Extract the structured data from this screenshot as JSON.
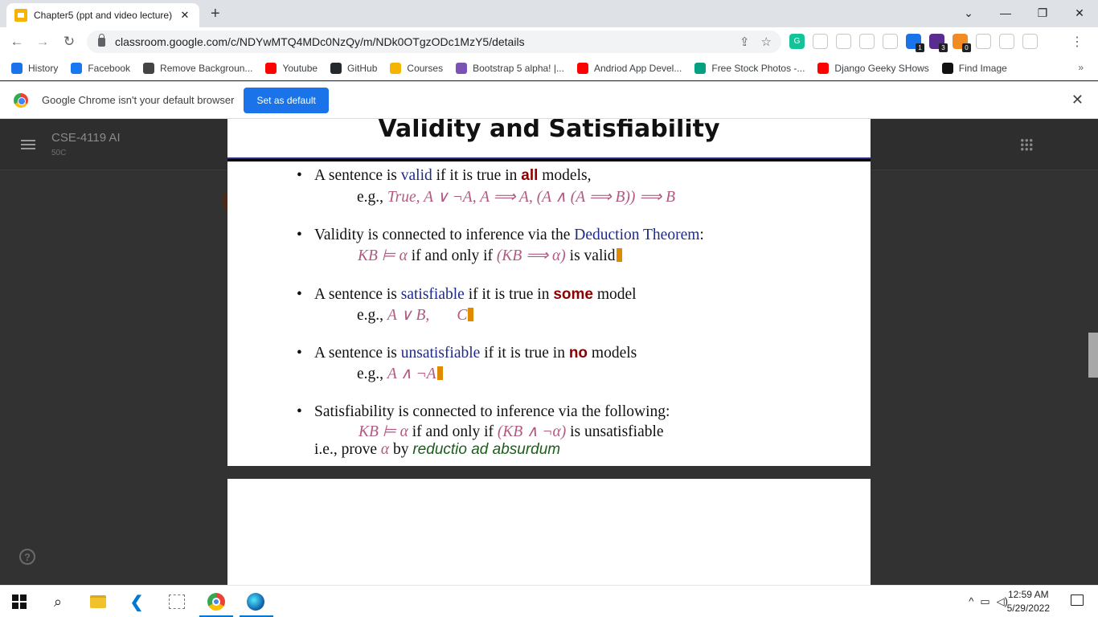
{
  "browser": {
    "tab_title": "Chapter5 (ppt and video lecture)",
    "tab_close": "✕",
    "new_tab": "+",
    "url": "classroom.google.com/c/NDYwMTQ4MDc0NzQy/m/NDk0OTgzODc1MzY5/details",
    "window_controls": {
      "dropdown": "⌄",
      "minimize": "—",
      "restore": "❐",
      "close": "✕"
    },
    "nav": {
      "back": "←",
      "forward": "→",
      "reload": "↻"
    },
    "extensions": [
      {
        "name": "grammarly-icon",
        "color": "#15c39a",
        "label": "G",
        "badge": ""
      },
      {
        "name": "runner-icon",
        "color": "#ffffff",
        "label": "",
        "badge": ""
      },
      {
        "name": "eyedropper-icon",
        "color": "#ffffff",
        "label": "",
        "badge": ""
      },
      {
        "name": "bug-icon",
        "color": "#ffffff",
        "label": "",
        "badge": ""
      },
      {
        "name": "window-icon",
        "color": "#ffffff",
        "label": "",
        "badge": ""
      },
      {
        "name": "figure-icon",
        "color": "#1a73e8",
        "label": "",
        "badge": "1"
      },
      {
        "name": "cube-icon",
        "color": "#5b2c8f",
        "label": "",
        "badge": "3"
      },
      {
        "name": "orange-icon",
        "color": "#f28b22",
        "label": "",
        "badge": "0"
      },
      {
        "name": "puzzle-icon",
        "color": "#ffffff",
        "label": "",
        "badge": ""
      },
      {
        "name": "sidepanel-icon",
        "color": "#ffffff",
        "label": "",
        "badge": ""
      },
      {
        "name": "profile-icon",
        "color": "#ffffff",
        "label": "",
        "badge": ""
      }
    ]
  },
  "bookmarks": [
    {
      "label": "History",
      "icon": "history-icon",
      "color": "#1a73e8"
    },
    {
      "label": "Facebook",
      "icon": "facebook-icon",
      "color": "#1877f2"
    },
    {
      "label": "Remove Backgroun...",
      "icon": "layers-icon",
      "color": "#444444"
    },
    {
      "label": "Youtube",
      "icon": "youtube-icon",
      "color": "#ff0000"
    },
    {
      "label": "GitHub",
      "icon": "github-icon",
      "color": "#24292e"
    },
    {
      "label": "Courses",
      "icon": "courses-icon",
      "color": "#f4b400"
    },
    {
      "label": "Bootstrap 5 alpha! |...",
      "icon": "bootstrap-icon",
      "color": "#7952b3"
    },
    {
      "label": "Andriod App Devel...",
      "icon": "youtube-icon",
      "color": "#ff0000"
    },
    {
      "label": "Free Stock Photos -...",
      "icon": "stock-icon",
      "color": "#05a081"
    },
    {
      "label": "Django Geeky SHows",
      "icon": "youtube-icon",
      "color": "#ff0000"
    },
    {
      "label": "Find Image",
      "icon": "find-image-icon",
      "color": "#111111"
    }
  ],
  "bookmarks_more": "»",
  "infobar": {
    "message": "Google Chrome isn't your default browser",
    "button": "Set as default",
    "close": "✕"
  },
  "classroom": {
    "course_name": "CSE-4119 AI",
    "section": "50C",
    "help": "?"
  },
  "slide": {
    "title": "Validity and Satisfiability",
    "b1": {
      "pre": "A sentence is ",
      "kw": "valid",
      "mid": " if it is true in ",
      "em": "all",
      "post": " models,",
      "eg": "e.g., ",
      "math": "True,   A ∨ ¬A,    A ⟹ A,    (A ∧ (A ⟹ B)) ⟹ B"
    },
    "b2": {
      "pre": "Validity is connected to inference via the ",
      "kw": "Deduction Theorem",
      "post": ":",
      "math1": "KB ⊨ α",
      "mid": " if and only if ",
      "math2": "(KB ⟹ α)",
      "post2": " is valid"
    },
    "b3": {
      "pre": "A sentence is ",
      "kw": "satisfiable",
      "mid": " if it is true in ",
      "em": "some",
      "post": " model",
      "eg": "e.g., ",
      "math": "A ∨ B,       C"
    },
    "b4": {
      "pre": "A sentence is ",
      "kw": "unsatisfiable",
      "mid": " if it is true in ",
      "em": "no",
      "post": " models",
      "eg": "e.g., ",
      "math": "A ∧ ¬A"
    },
    "b5": {
      "text": "Satisfiability is connected to inference via the following:",
      "math1": "KB ⊨ α",
      "mid": " if and only if ",
      "math2": "(KB ∧ ¬α)",
      "post": " is unsatisfiable",
      "ie": "i.e., prove ",
      "alpha": "α",
      "by": " by ",
      "latin": "reductio ad absurdum"
    }
  },
  "taskbar": {
    "time": "12:59 AM",
    "date": "5/29/2022",
    "tray": "^"
  }
}
